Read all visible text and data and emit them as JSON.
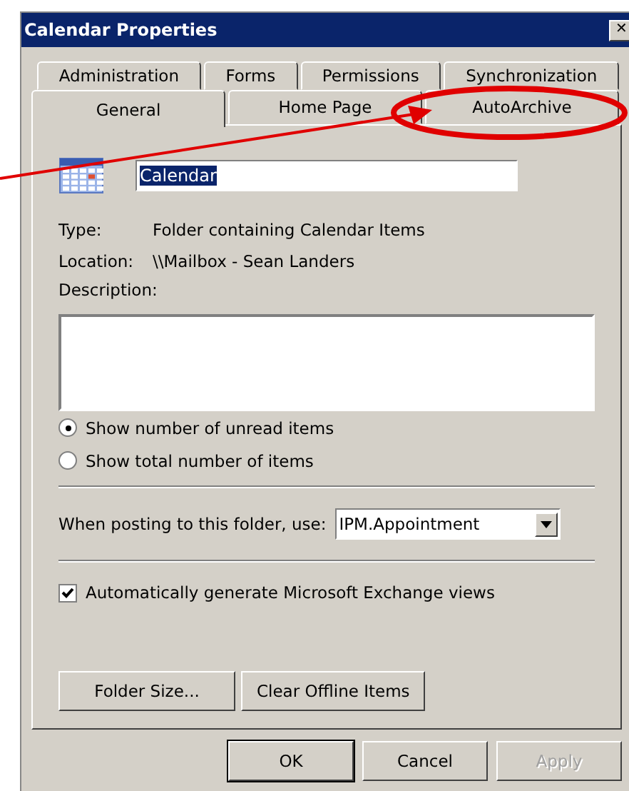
{
  "window": {
    "title": "Calendar Properties",
    "close": "✕"
  },
  "tab_rows": [
    [
      {
        "label": "Administration",
        "selected": false
      },
      {
        "label": "Forms",
        "selected": false
      },
      {
        "label": "Permissions",
        "selected": false
      },
      {
        "label": "Synchronization",
        "selected": false
      }
    ],
    [
      {
        "label": "General",
        "selected": true
      },
      {
        "label": "Home Page",
        "selected": false
      },
      {
        "label": "AutoArchive",
        "selected": false
      }
    ]
  ],
  "name_field": {
    "value": "Calendar"
  },
  "info": [
    {
      "label": "Type:",
      "value": "Folder containing Calendar Items"
    },
    {
      "label": "Location:",
      "value": "\\\\Mailbox - Sean Landers"
    }
  ],
  "description": {
    "label": "Description:"
  },
  "radios": [
    {
      "label": "Show number of unread items",
      "selected": true
    },
    {
      "label": "Show total number of items",
      "selected": false
    }
  ],
  "posting": {
    "label": "When posting to this folder, use:",
    "value": "IPM.Appointment"
  },
  "checkbox": {
    "label": "Automatically generate Microsoft Exchange views",
    "checked": true
  },
  "panel_buttons": [
    "Folder Size...",
    "Clear Offline Items"
  ],
  "dialog_buttons": [
    {
      "label": "OK",
      "disabled": false,
      "default": true
    },
    {
      "label": "Cancel",
      "disabled": false,
      "default": false
    },
    {
      "label": "Apply",
      "disabled": true,
      "default": false
    }
  ]
}
